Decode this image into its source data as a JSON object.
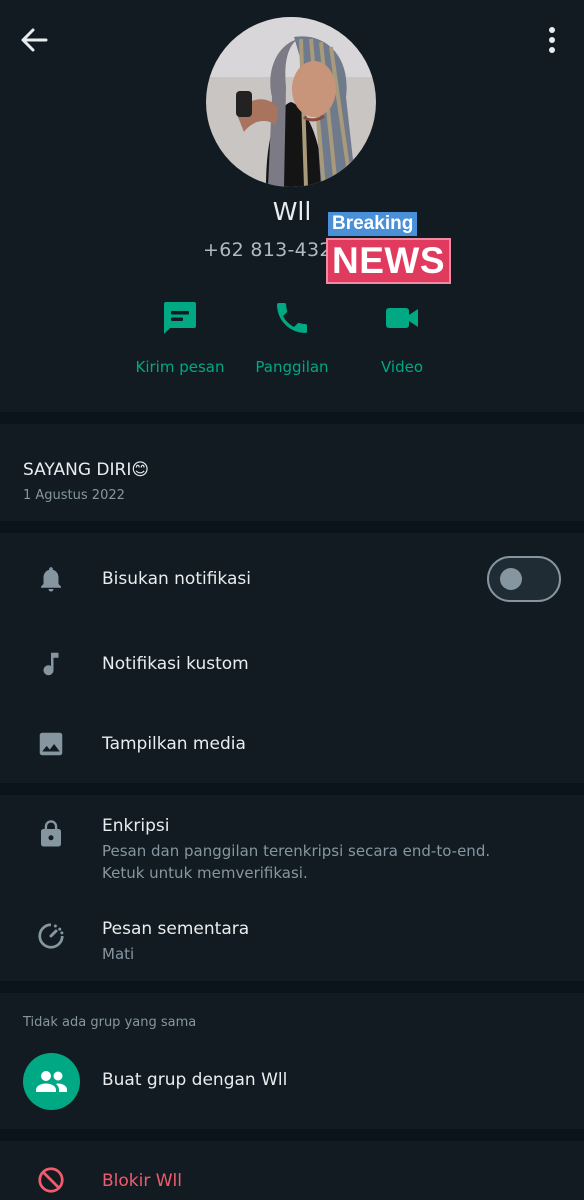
{
  "profile": {
    "name": "Wll",
    "phone": "+62 813-432",
    "badge_top": "Breaking",
    "badge_bottom": "NEWS"
  },
  "actions": {
    "message": "Kirim pesan",
    "call": "Panggilan",
    "video": "Video"
  },
  "about": {
    "text": "SAYANG DIRI😊",
    "date": "1 Agustus 2022"
  },
  "settings": {
    "mute": "Bisukan notifikasi",
    "mute_enabled": false,
    "custom": "Notifikasi kustom",
    "media": "Tampilkan media"
  },
  "security": {
    "encryption_title": "Enkripsi",
    "encryption_line1": "Pesan dan panggilan terenkripsi secara end-to-end.",
    "encryption_line2": "Ketuk untuk memverifikasi.",
    "disappearing_title": "Pesan sementara",
    "disappearing_value": "Mati"
  },
  "groups": {
    "header": "Tidak ada grup yang sama",
    "create": "Buat grup dengan Wll"
  },
  "block": {
    "label": "Blokir Wll"
  },
  "colors": {
    "accent": "#00a884",
    "danger": "#f15c6d",
    "background": "#111b21",
    "divider": "#0b141a"
  }
}
